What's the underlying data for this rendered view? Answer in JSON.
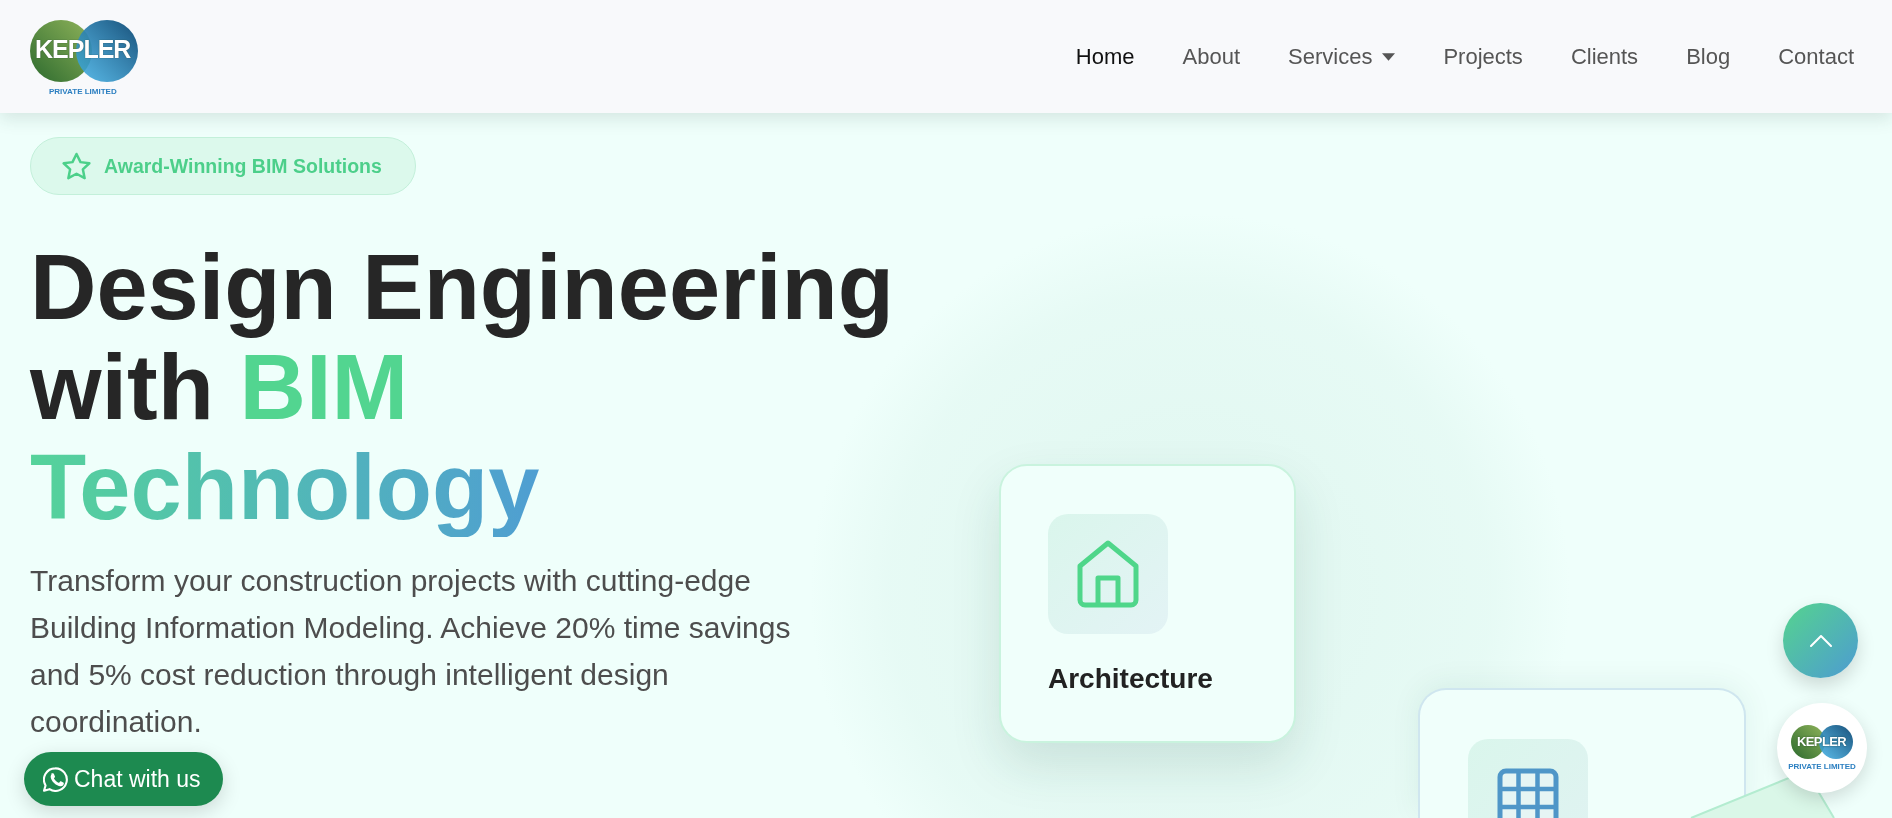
{
  "header": {
    "logo": {
      "wordmark": "KEPLER",
      "tagline": "PRIVATE LIMITED"
    },
    "nav": [
      {
        "label": "Home",
        "selected": true,
        "dropdown": false
      },
      {
        "label": "About",
        "selected": false,
        "dropdown": false
      },
      {
        "label": "Services",
        "selected": false,
        "dropdown": true
      },
      {
        "label": "Projects",
        "selected": false,
        "dropdown": false
      },
      {
        "label": "Clients",
        "selected": false,
        "dropdown": false
      },
      {
        "label": "Blog",
        "selected": false,
        "dropdown": false
      },
      {
        "label": "Contact",
        "selected": false,
        "dropdown": false
      }
    ]
  },
  "hero": {
    "badge": "Award-Winning BIM Solutions",
    "heading": [
      {
        "parts": [
          {
            "text": "Design Engineering",
            "kind": "plain"
          }
        ]
      },
      {
        "parts": [
          {
            "text": "with",
            "kind": "plain"
          },
          {
            "text": "BIM",
            "kind": "accent"
          }
        ]
      },
      {
        "parts": [
          {
            "text": "Technology",
            "kind": "gradient"
          }
        ]
      }
    ],
    "description": "Transform your construction projects with cutting-edge Building Information Modeling. Achieve 20% time savings and 5% cost reduction through intelligent design coordination."
  },
  "cards": [
    {
      "kind": "house",
      "title": "Architecture"
    },
    {
      "kind": "grid"
    }
  ],
  "floating": {
    "chat_label": "Chat with us",
    "logo": {
      "wordmark": "KEPLER",
      "tagline": "PRIVATE LIMITED"
    }
  }
}
